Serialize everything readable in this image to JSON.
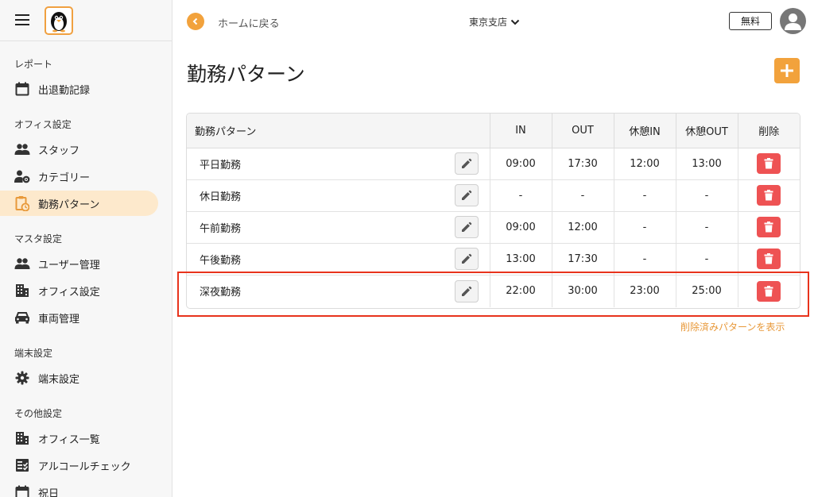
{
  "sidebar": {
    "sections": [
      {
        "label": "レポート",
        "items": [
          {
            "label": "出退勤記録",
            "icon": "calendar-icon"
          }
        ]
      },
      {
        "label": "オフィス設定",
        "items": [
          {
            "label": "スタッフ",
            "icon": "people-icon"
          },
          {
            "label": "カテゴリー",
            "icon": "person-gear-icon"
          },
          {
            "label": "勤務パターン",
            "icon": "clipboard-clock-icon",
            "active": true
          }
        ]
      },
      {
        "label": "マスタ設定",
        "items": [
          {
            "label": "ユーザー管理",
            "icon": "people-icon"
          },
          {
            "label": "オフィス設定",
            "icon": "building-icon"
          },
          {
            "label": "車両管理",
            "icon": "car-icon"
          }
        ]
      },
      {
        "label": "端末設定",
        "items": [
          {
            "label": "端末設定",
            "icon": "gear-icon"
          }
        ]
      },
      {
        "label": "その他設定",
        "items": [
          {
            "label": "オフィス一覧",
            "icon": "building-icon"
          },
          {
            "label": "アルコールチェック",
            "icon": "checklist-icon"
          },
          {
            "label": "祝日",
            "icon": "calendar-icon"
          }
        ]
      }
    ]
  },
  "header": {
    "back_label": "ホームに戻る",
    "branch": "東京支店",
    "plan_badge": "無料"
  },
  "page": {
    "title": "勤務パターン",
    "show_deleted": "削除済みパターンを表示"
  },
  "table": {
    "headers": [
      "勤務パターン",
      "IN",
      "OUT",
      "休憩IN",
      "休憩OUT",
      "削除"
    ],
    "rows": [
      {
        "name": "平日勤務",
        "in": "09:00",
        "out": "17:30",
        "break_in": "12:00",
        "break_out": "13:00"
      },
      {
        "name": "休日勤務",
        "in": "-",
        "out": "-",
        "break_in": "-",
        "break_out": "-"
      },
      {
        "name": "午前勤務",
        "in": "09:00",
        "out": "12:00",
        "break_in": "-",
        "break_out": "-"
      },
      {
        "name": "午後勤務",
        "in": "13:00",
        "out": "17:30",
        "break_in": "-",
        "break_out": "-"
      },
      {
        "name": "深夜勤務",
        "in": "22:00",
        "out": "30:00",
        "break_in": "23:00",
        "break_out": "25:00"
      }
    ]
  },
  "colors": {
    "accent": "#f2a23c",
    "active_bg": "#fde9cc",
    "delete": "#ee5253",
    "highlight": "#e8331c"
  }
}
